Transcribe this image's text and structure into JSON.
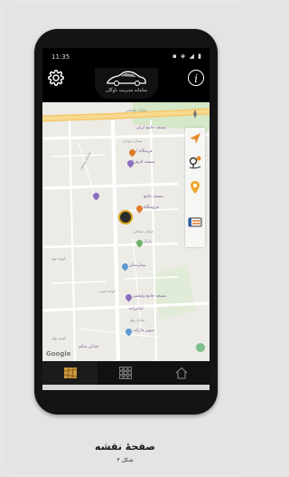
{
  "status_bar": {
    "time": "11:35",
    "icons": "▪ ◈ ◢ ▮"
  },
  "header": {
    "logo_text": "سامانه مدیریت ناوگان",
    "info_glyph": "i"
  },
  "map": {
    "poi_labels": [
      "مسجد جامع ایران",
      "فرشگاه ایران",
      "مسجد الزهرا",
      "مسجد جامع",
      "فروشگاه",
      "پارک",
      "بیمارستان",
      "مسجد جامع ولیعصر",
      "امامزاده",
      "سوپر مارکت",
      "خیابان سالم"
    ],
    "street_labels": [
      "خیابان ولیعصر",
      "میدان بروجرد",
      "خیابان یوسف",
      "خیابان صادقی",
      "کوچه نهم",
      "کوچه امینی",
      "خیابان بهار",
      "کوچه بهار"
    ],
    "google_label": "Google"
  },
  "bottom_nav": {
    "items": [
      {
        "name": "map",
        "active": true
      },
      {
        "name": "grid",
        "active": false
      },
      {
        "name": "home",
        "active": false
      }
    ]
  },
  "caption": {
    "title": "صفحهٔ نقشه",
    "subtitle": "شکل ۴"
  },
  "colors": {
    "accent": "#d9a31a",
    "primary": "#000000"
  }
}
